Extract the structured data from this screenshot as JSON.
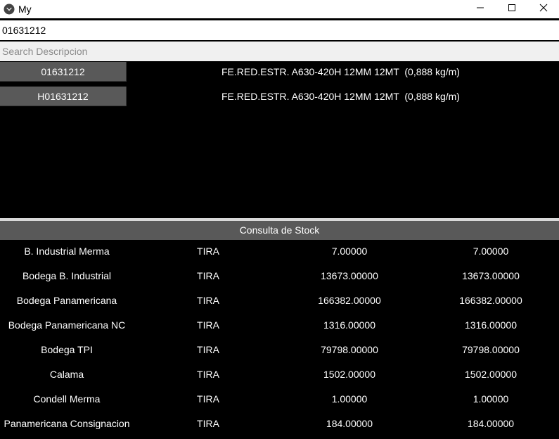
{
  "window": {
    "title": "My",
    "icon": "app-logo-icon",
    "controls": {
      "minimize": "minimize-icon",
      "maximize": "maximize-icon",
      "close": "close-icon"
    }
  },
  "code_input": {
    "value": "01631212"
  },
  "search": {
    "placeholder": "Search Descripcion",
    "value": ""
  },
  "results": [
    {
      "code": "01631212",
      "description": "FE.RED.ESTR. A630-420H 12MM 12MT  (0,888 kg/m)"
    },
    {
      "code": "H01631212",
      "description": "FE.RED.ESTR. A630-420H 12MM 12MT  (0,888 kg/m)"
    }
  ],
  "stock": {
    "header": "Consulta de Stock",
    "rows": [
      {
        "bodega": "B. Industrial Merma",
        "unit": "TIRA",
        "qty1": "7.00000",
        "qty2": "7.00000"
      },
      {
        "bodega": "Bodega B. Industrial",
        "unit": "TIRA",
        "qty1": "13673.00000",
        "qty2": "13673.00000"
      },
      {
        "bodega": "Bodega Panamericana",
        "unit": "TIRA",
        "qty1": "166382.00000",
        "qty2": "166382.00000"
      },
      {
        "bodega": "Bodega Panamericana NC",
        "unit": "TIRA",
        "qty1": "1316.00000",
        "qty2": "1316.00000"
      },
      {
        "bodega": "Bodega TPI",
        "unit": "TIRA",
        "qty1": "79798.00000",
        "qty2": "79798.00000"
      },
      {
        "bodega": "Calama",
        "unit": "TIRA",
        "qty1": "1502.00000",
        "qty2": "1502.00000"
      },
      {
        "bodega": "Condell Merma",
        "unit": "TIRA",
        "qty1": "1.00000",
        "qty2": "1.00000"
      },
      {
        "bodega": "Panamericana Consignacion",
        "unit": "TIRA",
        "qty1": "184.00000",
        "qty2": "184.00000"
      }
    ]
  },
  "colors": {
    "background": "#000000",
    "button": "#595959",
    "text": "#ffffff"
  }
}
